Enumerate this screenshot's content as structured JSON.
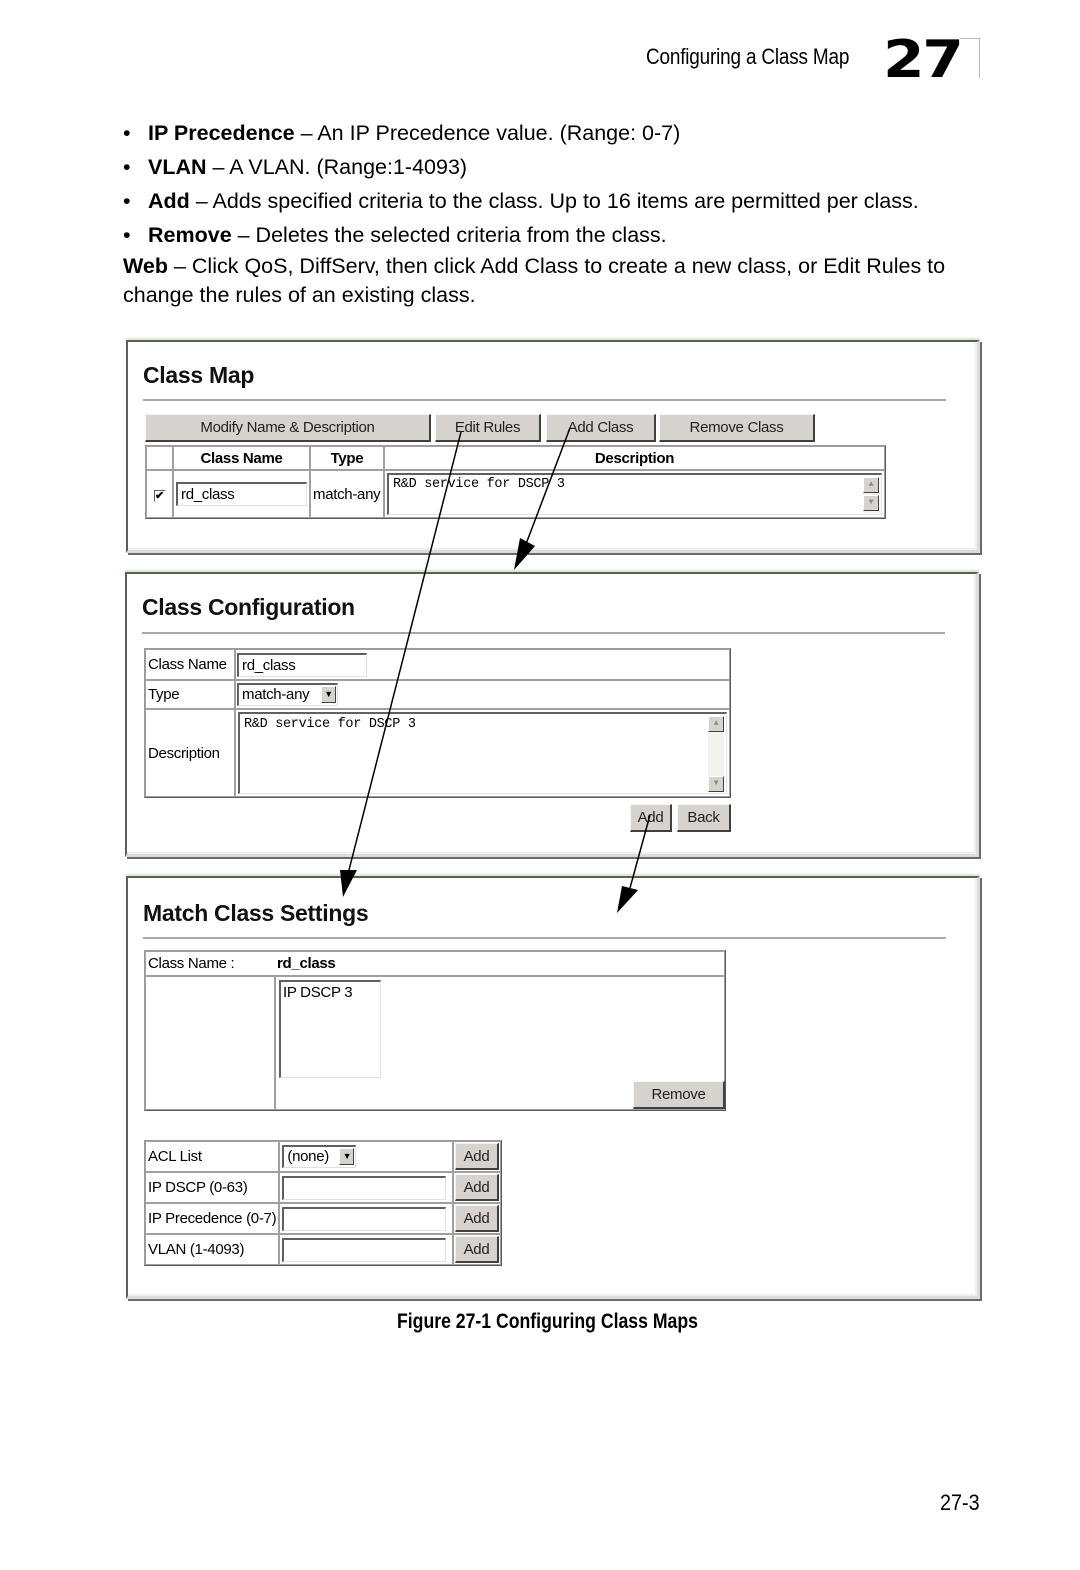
{
  "header": {
    "running_title": "Configuring a Class Map",
    "chapter_number": "27"
  },
  "body": {
    "bullets": [
      {
        "term": "IP Precedence",
        "text": " – An IP Precedence value. (Range: 0-7)"
      },
      {
        "term": "VLAN",
        "text": " – A VLAN. (Range:1-4093)"
      },
      {
        "term": "Add",
        "text": " – Adds specified criteria to the class. Up to 16 items are permitted per class."
      },
      {
        "term": "Remove",
        "text": " – Deletes the selected criteria from the class."
      }
    ],
    "web_para": {
      "term": "Web",
      "text": " – Click QoS, DiffServ, then click Add Class to create a new class, or Edit Rules to change the rules of an existing class."
    }
  },
  "class_map": {
    "title": "Class Map",
    "buttons": {
      "modify": "Modify Name & Description",
      "edit_rules": "Edit Rules",
      "add_class": "Add Class",
      "remove_class": "Remove Class"
    },
    "columns": [
      "Class Name",
      "Type",
      "Description"
    ],
    "rows": [
      {
        "checked": true,
        "check_glyph": "✔",
        "class_name": "rd_class",
        "type": "match-any",
        "description": "R&D service for DSCP 3"
      }
    ]
  },
  "class_config": {
    "title": "Class Configuration",
    "labels": {
      "class_name": "Class Name",
      "type": "Type",
      "description": "Description"
    },
    "class_name_value": "rd_class",
    "type_value": "match-any",
    "description_value": "R&D service for DSCP 3",
    "buttons": {
      "add": "Add",
      "back": "Back"
    }
  },
  "match_class": {
    "title": "Match Class Settings",
    "class_name_label": "Class Name :",
    "class_name_value": "rd_class",
    "rules": [
      "IP DSCP 3"
    ],
    "remove_label": "Remove",
    "criteria": [
      {
        "label": "ACL List",
        "kind": "select",
        "value": "(none)",
        "button": "Add"
      },
      {
        "label": "IP DSCP (0-63)",
        "kind": "input",
        "value": "",
        "button": "Add"
      },
      {
        "label": "IP Precedence (0-7)",
        "kind": "input",
        "value": "",
        "button": "Add"
      },
      {
        "label": "VLAN (1-4093)",
        "kind": "input",
        "value": "",
        "button": "Add"
      }
    ]
  },
  "icons": {
    "dropdown_arrow": "▼",
    "scroll_up": "▲",
    "scroll_down": "▼"
  },
  "figure": {
    "caption": "Figure 27-1  Configuring Class Maps"
  },
  "footer": {
    "page_number": "27-3"
  }
}
